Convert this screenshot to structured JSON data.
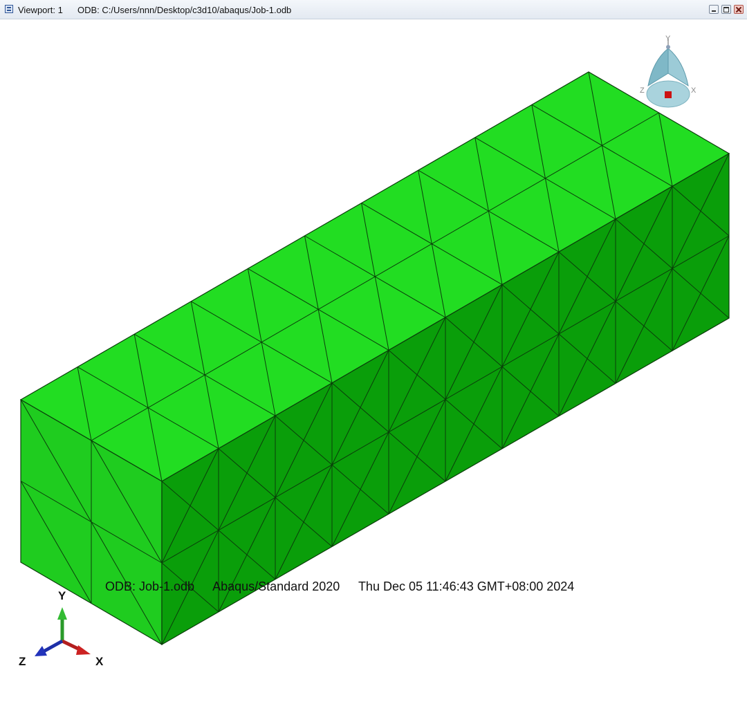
{
  "window": {
    "viewport_label": "Viewport: 1",
    "odb_path": "ODB: C:/Users/nnn/Desktop/c3d10/abaqus/Job-1.odb"
  },
  "info": {
    "odb": "ODB: Job-1.odb",
    "solver": "Abaqus/Standard 2020",
    "timestamp": "Thu Dec 05 11:46:43 GMT+08:00 2024"
  },
  "triad": {
    "y": "Y",
    "z": "Z",
    "x": "X"
  },
  "view_cube": {
    "y": "Y",
    "z": "Z",
    "x": "X"
  },
  "mesh": {
    "top_color": "#22dd22",
    "front_color": "#1fcc1f",
    "side_color": "#0a9e0a",
    "edge_color": "#0b3d0b",
    "length_divisions": 10,
    "width_divisions": 2,
    "height_divisions": 2
  },
  "icons": [
    "viewport-window-icon",
    "minimize-icon",
    "restore-icon",
    "close-icon",
    "view-cube-icon",
    "axis-triad-icon"
  ]
}
